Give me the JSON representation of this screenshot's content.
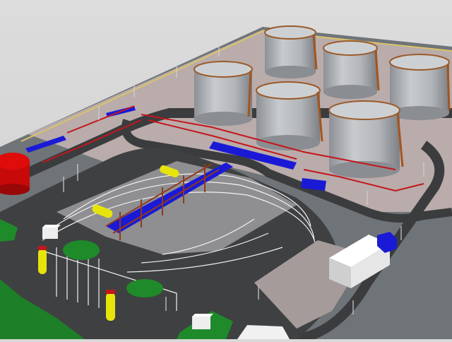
{
  "scene": {
    "kind": "3D render of a fuel storage terminal",
    "colors": {
      "background": "#d9d9d9",
      "ground": "#6e7378",
      "slab": "#b7aaa8",
      "asphalt": "#3d3d3f",
      "grass": "#1f8a2a",
      "tank": "#b9bcc0",
      "tank_roof": "#c9cbce",
      "stair": "#a2551f",
      "pipe_blue": "#1a1ad6",
      "pipe_red": "#c4161c",
      "truck_yellow": "#e7e40c",
      "red_tank": "#e00b0b",
      "building": "#efefef"
    },
    "tank_count": 6,
    "truck_count": 4
  }
}
